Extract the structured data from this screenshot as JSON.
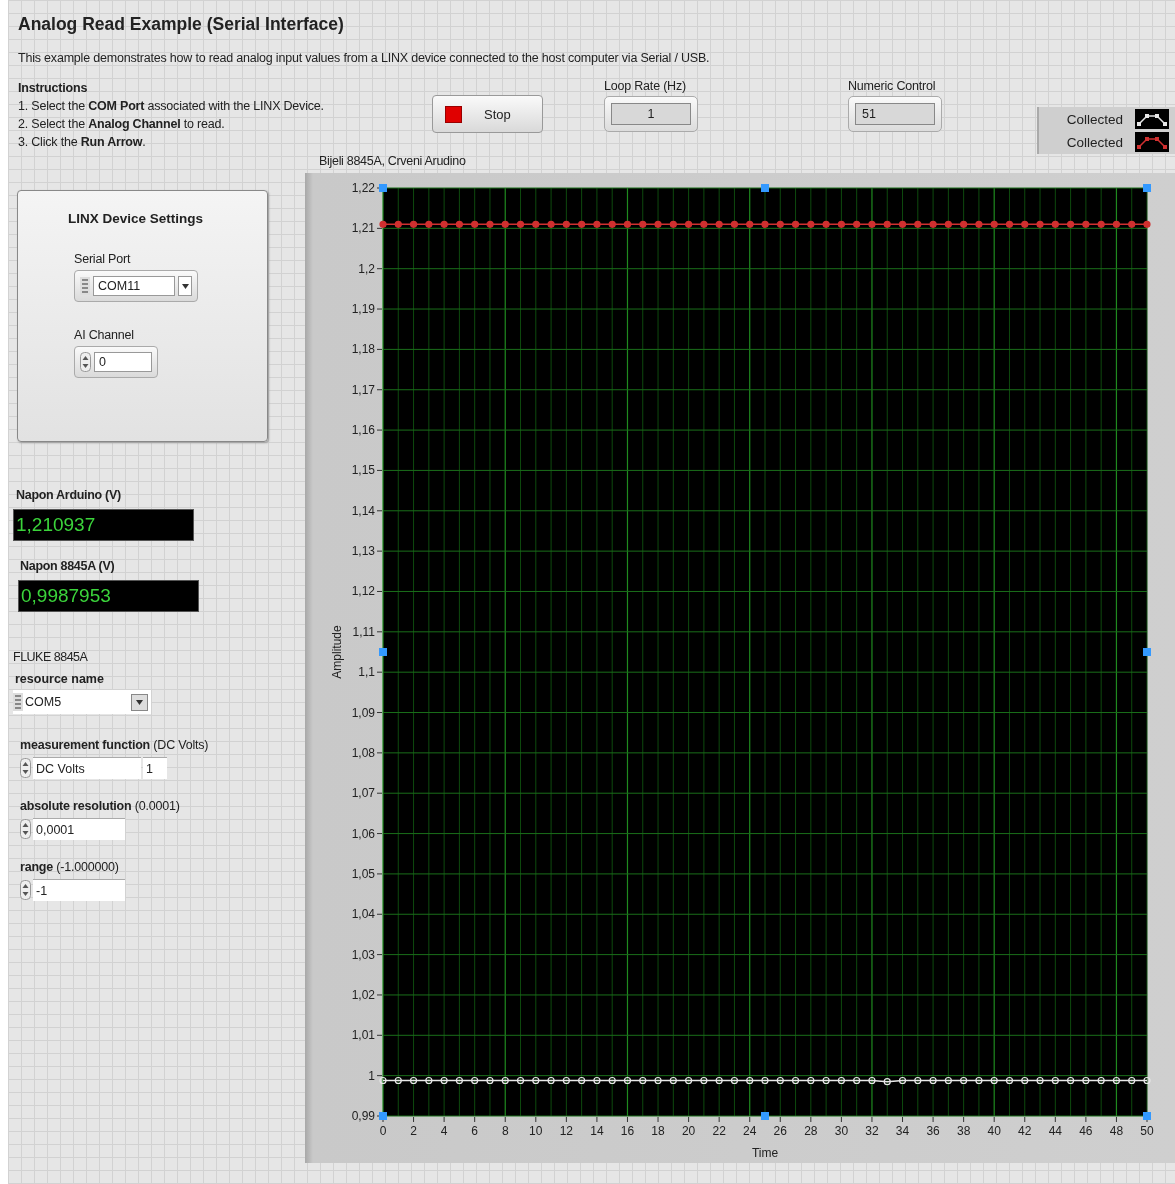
{
  "title": "Analog Read Example (Serial Interface)",
  "description": "This example demonstrates how to read analog input values from a LINX device connected to the host computer via Serial / USB.",
  "instructions": {
    "heading": "Instructions",
    "steps": [
      "1. Select the **COM Port** associated with the LINX Device.",
      "2. Select the **Analog Channel** to read.",
      "3. Click the **Run Arrow**."
    ]
  },
  "stop_button": {
    "label": "Stop"
  },
  "loop_rate": {
    "label": "Loop Rate (Hz)",
    "value": "1"
  },
  "numeric_control": {
    "label": "Numeric Control",
    "value": "51"
  },
  "linx_settings": {
    "title": "LINX Device Settings",
    "serial_port": {
      "label": "Serial Port",
      "value": "COM11"
    },
    "ai_channel": {
      "label": "AI Channel",
      "value": "0"
    }
  },
  "indicators": [
    {
      "label": "Napon Arduino (V)",
      "value": "1,210937"
    },
    {
      "label": "Napon 8845A (V)",
      "value": "0,9987953"
    }
  ],
  "fluke": {
    "title": "FLUKE 8845A",
    "resource_name": {
      "label": "resource name",
      "value": "COM5"
    },
    "controls": [
      {
        "label": "**measurement function** (DC Volts)",
        "value": "DC Volts",
        "index": "1"
      },
      {
        "label": "**absolute resolution** (0.0001)",
        "value": "0,0001"
      },
      {
        "label": "**range** (-1.000000)",
        "value": "-1"
      }
    ]
  },
  "graph": {
    "caption": "Bijeli 8845A, Crveni Arudino",
    "chart_data": {
      "type": "line",
      "grid": true,
      "xlabel": "Time",
      "ylabel": "Amplitude",
      "x": [
        0,
        1,
        2,
        3,
        4,
        5,
        6,
        7,
        8,
        9,
        10,
        11,
        12,
        13,
        14,
        15,
        16,
        17,
        18,
        19,
        20,
        21,
        22,
        23,
        24,
        25,
        26,
        27,
        28,
        29,
        30,
        31,
        32,
        33,
        34,
        35,
        36,
        37,
        38,
        39,
        40,
        41,
        42,
        43,
        44,
        45,
        46,
        47,
        48,
        49,
        50
      ],
      "series": [
        {
          "name": "Collected",
          "color": "#e8e8e8",
          "marker": "circle-open",
          "values": [
            0.9988,
            0.9988,
            0.9988,
            0.9988,
            0.9988,
            0.9988,
            0.9988,
            0.9988,
            0.9988,
            0.9988,
            0.9988,
            0.9988,
            0.9988,
            0.9988,
            0.9988,
            0.9988,
            0.9988,
            0.9988,
            0.9988,
            0.9988,
            0.9988,
            0.9988,
            0.9988,
            0.9988,
            0.9988,
            0.9988,
            0.9988,
            0.9988,
            0.9988,
            0.9988,
            0.9988,
            0.9988,
            0.9988,
            0.9985,
            0.9988,
            0.9988,
            0.9988,
            0.9988,
            0.9988,
            0.9988,
            0.9988,
            0.9988,
            0.9988,
            0.9988,
            0.9988,
            0.9988,
            0.9988,
            0.9988,
            0.9988,
            0.9988,
            0.9988
          ]
        },
        {
          "name": "Collected",
          "color": "#d03030",
          "marker": "circle",
          "values": [
            1.211,
            1.211,
            1.211,
            1.211,
            1.211,
            1.211,
            1.211,
            1.211,
            1.211,
            1.211,
            1.211,
            1.211,
            1.211,
            1.211,
            1.211,
            1.211,
            1.211,
            1.211,
            1.211,
            1.211,
            1.211,
            1.211,
            1.211,
            1.211,
            1.211,
            1.211,
            1.211,
            1.211,
            1.211,
            1.211,
            1.211,
            1.211,
            1.211,
            1.211,
            1.211,
            1.211,
            1.211,
            1.211,
            1.211,
            1.211,
            1.211,
            1.211,
            1.211,
            1.211,
            1.211,
            1.211,
            1.211,
            1.211,
            1.211,
            1.211,
            1.211
          ]
        }
      ],
      "xlim": [
        0,
        50
      ],
      "ylim": [
        0.99,
        1.22
      ],
      "xticks": [
        0,
        2,
        4,
        6,
        8,
        10,
        12,
        14,
        16,
        18,
        20,
        22,
        24,
        26,
        28,
        30,
        32,
        34,
        36,
        38,
        40,
        42,
        44,
        46,
        48,
        50
      ],
      "yticks": [
        {
          "value": 0.99,
          "label": "0,99"
        },
        {
          "value": 1,
          "label": "1"
        },
        {
          "value": 1.01,
          "label": "1,01"
        },
        {
          "value": 1.02,
          "label": "1,02"
        },
        {
          "value": 1.03,
          "label": "1,03"
        },
        {
          "value": 1.04,
          "label": "1,04"
        },
        {
          "value": 1.05,
          "label": "1,05"
        },
        {
          "value": 1.06,
          "label": "1,06"
        },
        {
          "value": 1.07,
          "label": "1,07"
        },
        {
          "value": 1.08,
          "label": "1,08"
        },
        {
          "value": 1.09,
          "label": "1,09"
        },
        {
          "value": 1.1,
          "label": "1,1"
        },
        {
          "value": 1.11,
          "label": "1,11"
        },
        {
          "value": 1.12,
          "label": "1,12"
        },
        {
          "value": 1.13,
          "label": "1,13"
        },
        {
          "value": 1.14,
          "label": "1,14"
        },
        {
          "value": 1.15,
          "label": "1,15"
        },
        {
          "value": 1.16,
          "label": "1,16"
        },
        {
          "value": 1.17,
          "label": "1,17"
        },
        {
          "value": 1.18,
          "label": "1,18"
        },
        {
          "value": 1.19,
          "label": "1,19"
        },
        {
          "value": 1.2,
          "label": "1,2"
        },
        {
          "value": 1.21,
          "label": "1,21"
        },
        {
          "value": 1.22,
          "label": "1,22"
        }
      ]
    }
  }
}
